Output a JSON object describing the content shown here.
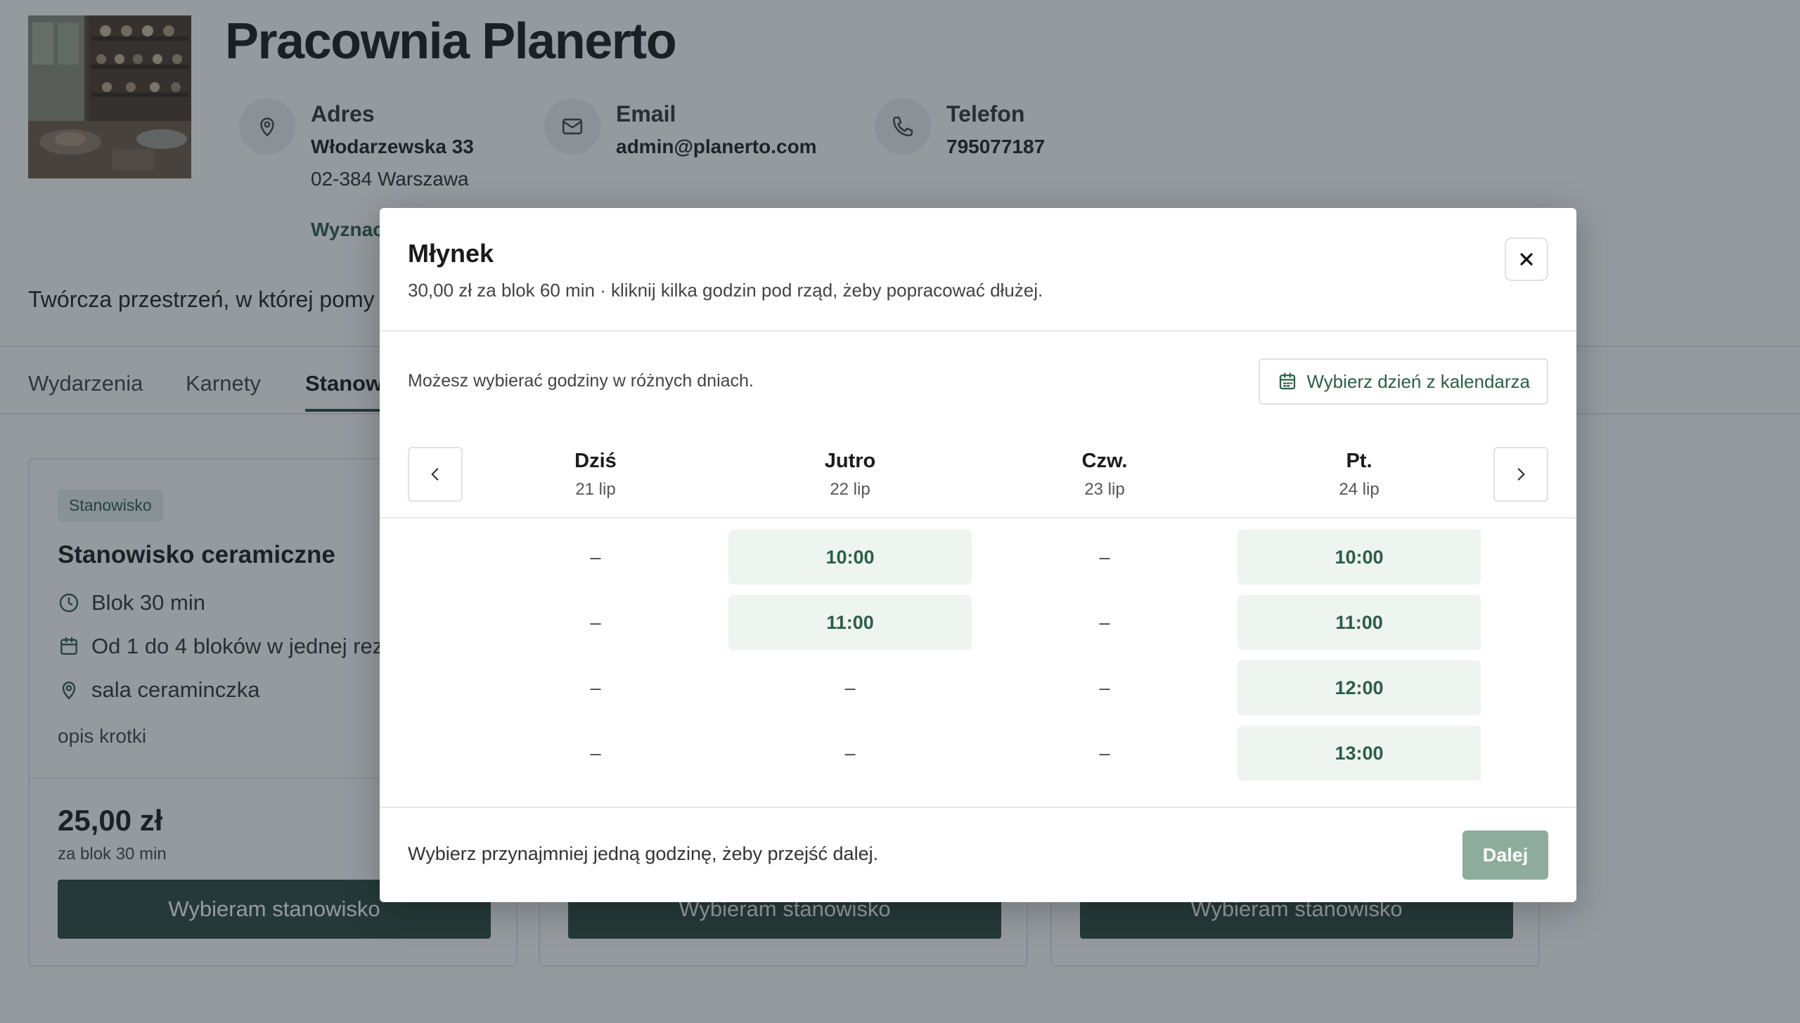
{
  "studio": {
    "title": "Pracownia Planerto",
    "description": "Twórcza przestrzeń, w której pomy"
  },
  "contact": {
    "address": {
      "label": "Adres",
      "line1": "Włodarzewska 33",
      "line2": "02-384 Warszawa",
      "link": "Wyznac"
    },
    "email": {
      "label": "Email",
      "value": "admin@planerto.com"
    },
    "phone": {
      "label": "Telefon",
      "value": "795077187"
    }
  },
  "tabs": [
    {
      "label": "Wydarzenia"
    },
    {
      "label": "Karnety"
    },
    {
      "label": "Stanowi"
    }
  ],
  "card": {
    "badge": "Stanowisko",
    "title": "Stanowisko ceramiczne",
    "block": "Blok 30 min",
    "range": "Od 1 do 4 bloków w jednej rez",
    "location": "sala ceraminczka",
    "short": "opis krotki",
    "price": "25,00 zł",
    "per": "za blok 30 min",
    "button": "Wybieram stanowisko"
  },
  "modal": {
    "title": "Młynek",
    "subtitle": "30,00 zł za blok 60 min · kliknij kilka godzin pod rząd, żeby popracować dłużej.",
    "hint": "Możesz wybierać godziny w różnych dniach.",
    "calendar_button": "Wybierz dzień z kalendarza",
    "days": [
      {
        "name": "Dziś",
        "date": "21 lip",
        "slots": [
          "–",
          "–",
          "–",
          "–"
        ]
      },
      {
        "name": "Jutro",
        "date": "22 lip",
        "slots": [
          "10:00",
          "11:00",
          "–",
          "–"
        ]
      },
      {
        "name": "Czw.",
        "date": "23 lip",
        "slots": [
          "–",
          "–",
          "–",
          "–"
        ]
      },
      {
        "name": "Pt.",
        "date": "24 lip",
        "slots": [
          "10:00",
          "11:00",
          "12:00",
          "13:00"
        ]
      }
    ],
    "footer_hint": "Wybierz przynajmniej jedną godzinę, żeby przejść dalej.",
    "next_button": "Dalej"
  },
  "colors": {
    "accent": "#2c4a3e",
    "accent_text": "#2c5e47",
    "slot_bg": "#eef4f0",
    "next_disabled": "#8eac9b"
  }
}
